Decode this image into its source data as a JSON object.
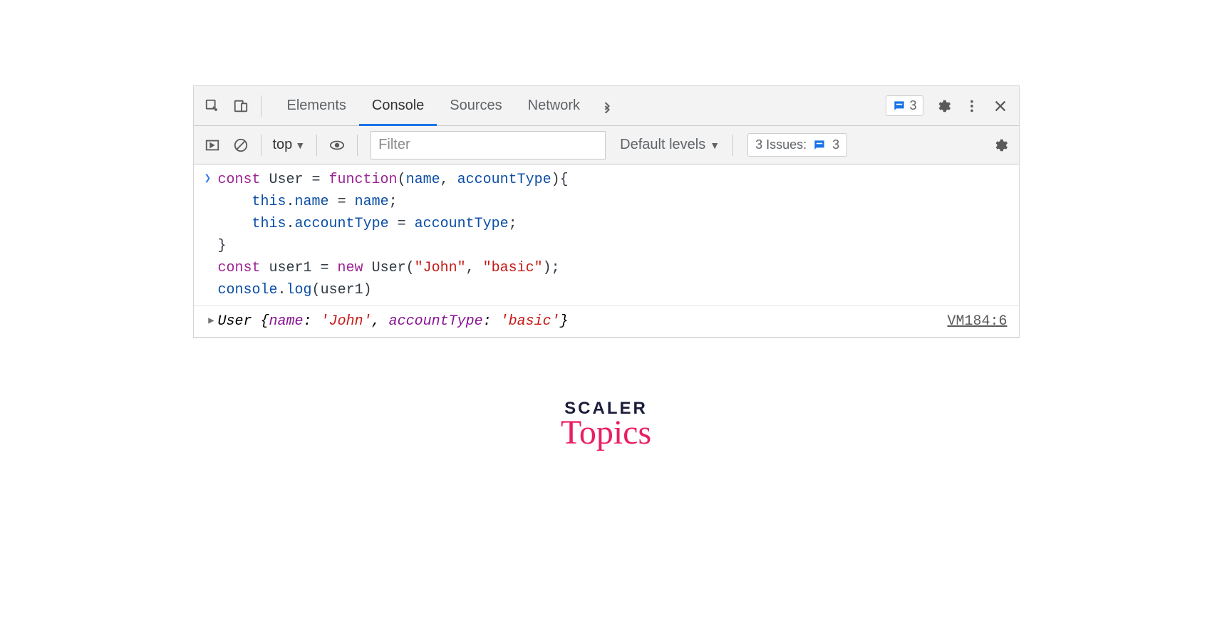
{
  "toolbar": {
    "tabs": [
      "Elements",
      "Console",
      "Sources",
      "Network"
    ],
    "active_tab": 1,
    "messages_count": "3"
  },
  "subbar": {
    "context": "top",
    "filter_placeholder": "Filter",
    "levels_label": "Default levels",
    "issues_label": "3 Issues:",
    "issues_count": "3"
  },
  "console": {
    "input_code": {
      "line1_kw": "const",
      "line1_var": " User ",
      "line1_eq": "= ",
      "line1_fn": "function",
      "line1_args_open": "(",
      "line1_arg1": "name",
      "line1_comma": ", ",
      "line1_arg2": "accountType",
      "line1_close": "){",
      "line2_indent": "    ",
      "line2_this": "this",
      "line2_dot": ".",
      "line2_prop": "name",
      "line2_eq": " = ",
      "line2_val": "name",
      "line2_semi": ";",
      "line3_indent": "    ",
      "line3_this": "this",
      "line3_dot": ".",
      "line3_prop": "accountType",
      "line3_eq": " = ",
      "line3_val": "accountType",
      "line3_semi": ";",
      "line4": "}",
      "line5_kw": "const",
      "line5_var": " user1 ",
      "line5_eq": "= ",
      "line5_new": "new",
      "line5_cls": " User(",
      "line5_s1": "\"John\"",
      "line5_comma": ", ",
      "line5_s2": "\"basic\"",
      "line5_close": ");",
      "line6_obj": "console",
      "line6_dot": ".",
      "line6_fn": "log",
      "line6_open": "(",
      "line6_arg": "user1",
      "line6_close": ")"
    },
    "output": {
      "class": "User ",
      "brace_open": "{",
      "key1": "name",
      "colon1": ": ",
      "val1": "'John'",
      "comma": ", ",
      "key2": "accountType",
      "colon2": ": ",
      "val2": "'basic'",
      "brace_close": "}",
      "source": "VM184:6"
    }
  },
  "branding": {
    "top": "SCALER",
    "bottom": "Topics"
  }
}
